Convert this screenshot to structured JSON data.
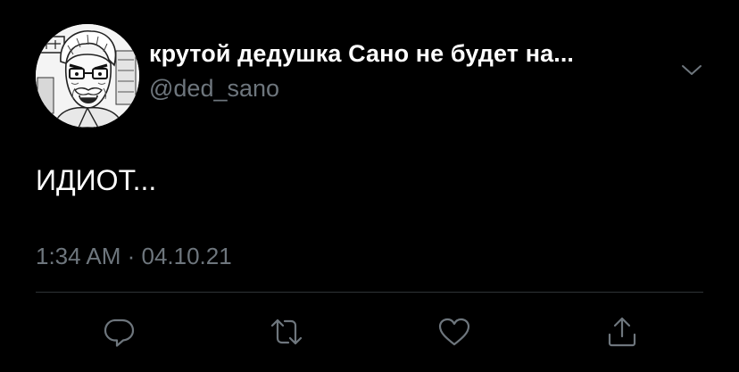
{
  "tweet": {
    "author_name": "крутой дедушка Сано не будет на...",
    "author_handle": "@ded_sano",
    "text": "ИДИОТ...",
    "timestamp": "1:34 AM · 04.10.21"
  },
  "icons": {
    "avatar": "manga-grandpa-avatar",
    "menu": "chevron-down-icon",
    "reply": "reply-icon",
    "retweet": "retweet-icon",
    "like": "heart-icon",
    "share": "share-icon"
  },
  "colors": {
    "background": "#000000",
    "primary_text": "#ffffff",
    "secondary_text": "#6e767d",
    "divider": "#2f3336"
  }
}
